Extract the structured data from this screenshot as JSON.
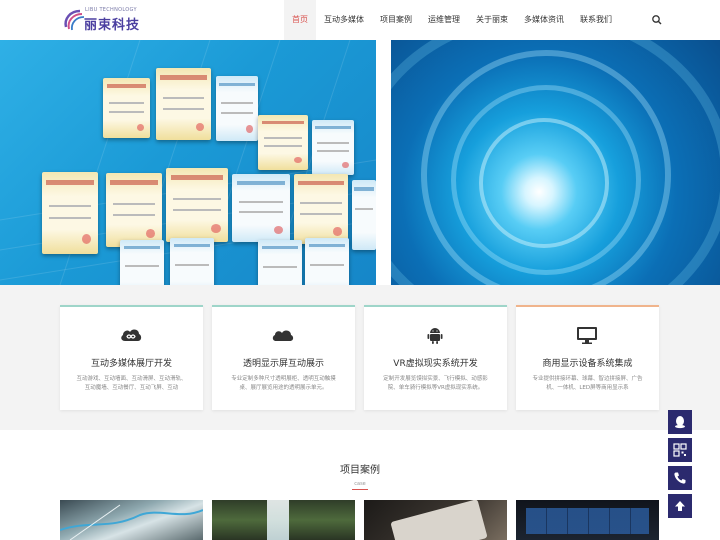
{
  "header": {
    "logo_en": "LIBU TECHNOLOGY",
    "logo_cn": "丽束科技",
    "nav": [
      {
        "label": "首页",
        "active": true
      },
      {
        "label": "互动多媒体",
        "active": false
      },
      {
        "label": "项目案例",
        "active": false
      },
      {
        "label": "运维管理",
        "active": false
      },
      {
        "label": "关于丽束",
        "active": false
      },
      {
        "label": "多媒体资讯",
        "active": false
      },
      {
        "label": "联系我们",
        "active": false
      }
    ],
    "search_icon": "search-icon"
  },
  "banner": {
    "slides": 3,
    "active_slide": 1
  },
  "services": [
    {
      "icon": "infinity-cloud-icon",
      "title": "互动多媒体展厅开发",
      "desc": "互动游戏、互动墙面、互动滑屏、互动滑轨、互动魔墙、互动餐厅、互动飞屏、互动",
      "accent": "#9ed5c9"
    },
    {
      "icon": "cloud-icon",
      "title": "透明显示屏互动展示",
      "desc": "专业定制多种尺寸透明展柜、透明互动触摸桌、展厅展览用途的透明展示单元。",
      "accent": "#9ed5c9"
    },
    {
      "icon": "android-icon",
      "title": "VR虚拟现实系统开发",
      "desc": "定制开发展览馍拟实景、飞行模拟、动感影院、单车骑行模拟等VR虚拟现实系统。",
      "accent": "#9ed5c9"
    },
    {
      "icon": "monitor-icon",
      "title": "商用显示设备系统集成",
      "desc": "专业提供拼接环幕、球幕、智边拼接屏、广告机、一体机、LED屏等商用显示系",
      "accent": "#f0b48c"
    }
  ],
  "cases": {
    "title": "项目案例",
    "subtitle": "case"
  },
  "float_buttons": [
    "qq-icon",
    "qrcode-icon",
    "phone-icon",
    "arrow-up-icon"
  ],
  "colors": {
    "brand": "#2b2a6e",
    "nav_active": "#d9534f",
    "banner_blue": "#1b9ad6"
  }
}
